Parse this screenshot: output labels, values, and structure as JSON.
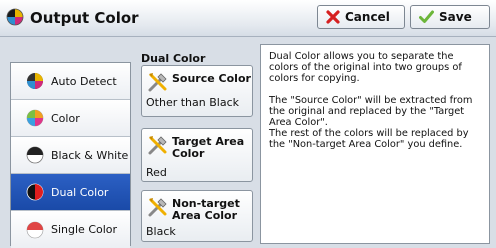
{
  "header": {
    "title": "Output Color",
    "cancel_label": "Cancel",
    "save_label": "Save"
  },
  "color_options": [
    {
      "label": "Auto Detect",
      "icon": "auto-detect-icon",
      "selected": false
    },
    {
      "label": "Color",
      "icon": "color-icon",
      "selected": false
    },
    {
      "label": "Black & White",
      "icon": "black-white-icon",
      "selected": false
    },
    {
      "label": "Dual Color",
      "icon": "dual-color-icon",
      "selected": true
    },
    {
      "label": "Single Color",
      "icon": "single-color-icon",
      "selected": false
    }
  ],
  "dual_color": {
    "heading": "Dual Color",
    "source": {
      "title": "Source Color",
      "value": "Other than Black"
    },
    "target": {
      "title": "Target Area Color",
      "value": "Red"
    },
    "non_target": {
      "title": "Non-target Area Color",
      "value": "Black"
    }
  },
  "description": {
    "p1": "Dual Color allows you to separate the colors of the original into two groups of colors for copying.",
    "p2": "The \"Source Color\" will be extracted from the original and replaced by the \"Target Area Color\".",
    "p3": "The rest of the colors will be replaced by the \"Non-target Area Color\" you define."
  },
  "colors": {
    "selected_bg": "#1a4aa8",
    "cancel_x": "#d62020",
    "save_check": "#6cb63a"
  }
}
